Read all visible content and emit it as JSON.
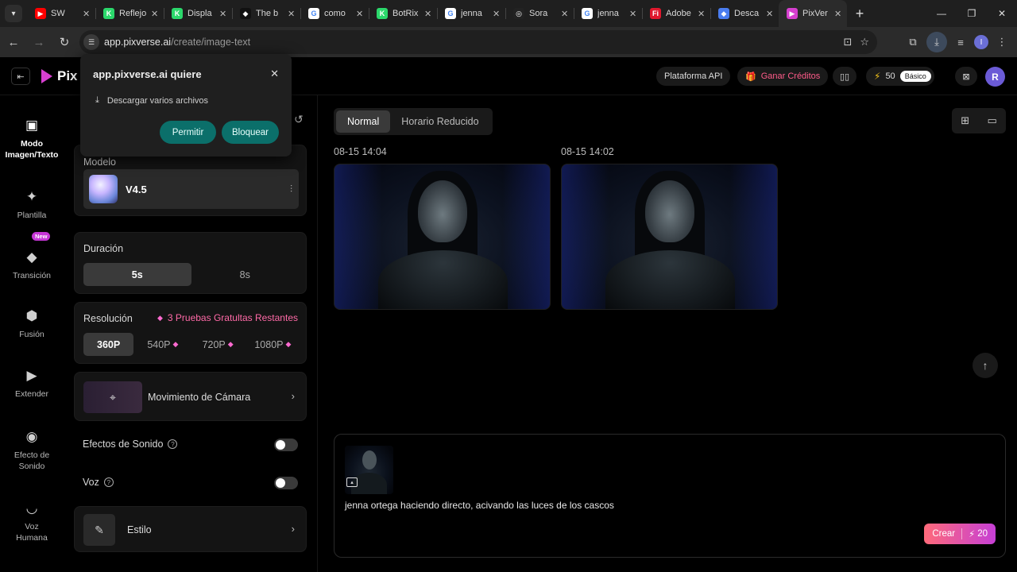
{
  "browser": {
    "tabs": [
      {
        "title": "SW",
        "favicon_color": "#ff0000",
        "favicon_glyph": "▶",
        "active": false
      },
      {
        "title": "Reflejo",
        "favicon_color": "#2bd86b",
        "favicon_glyph": "K",
        "active": false
      },
      {
        "title": "Displa",
        "favicon_color": "#2bd86b",
        "favicon_glyph": "K",
        "active": false
      },
      {
        "title": "The b",
        "favicon_color": "#111111",
        "favicon_glyph": "◆",
        "active": false
      },
      {
        "title": "como",
        "favicon_color": "#ffffff",
        "favicon_glyph": "G",
        "active": false
      },
      {
        "title": "BotRix",
        "favicon_color": "#2bd86b",
        "favicon_glyph": "K",
        "active": false
      },
      {
        "title": "jenna",
        "favicon_color": "#ffffff",
        "favicon_glyph": "G",
        "active": false
      },
      {
        "title": "Sora",
        "favicon_color": "#222222",
        "favicon_glyph": "◎",
        "active": false
      },
      {
        "title": "jenna",
        "favicon_color": "#ffffff",
        "favicon_glyph": "G",
        "active": false
      },
      {
        "title": "Adobe",
        "favicon_color": "#e0182d",
        "favicon_glyph": "Fi",
        "active": false
      },
      {
        "title": "Desca",
        "favicon_color": "#4a7df0",
        "favicon_glyph": "◆",
        "active": false
      },
      {
        "title": "PixVer",
        "favicon_color": "#d63fcf",
        "favicon_glyph": "▶",
        "active": true
      }
    ],
    "url_host": "app.pixverse.ai",
    "url_path": "/create/image-text",
    "profile_initial": "I"
  },
  "header": {
    "logo_text": "Pix",
    "api_label": "Plataforma API",
    "credits_label": "Ganar Créditos",
    "energy_value": "50",
    "plan_label": "Básico",
    "avatar_initial": "R"
  },
  "nav": {
    "items": [
      {
        "label": "Modo Imagen/Texto",
        "icon": "image-icon",
        "active": true
      },
      {
        "label": "Plantilla",
        "icon": "sparkle-icon",
        "active": false
      },
      {
        "label": "Transición",
        "icon": "diamond-icon",
        "active": false,
        "badge": "New"
      },
      {
        "label": "Fusión",
        "icon": "cube-icon",
        "active": false
      },
      {
        "label": "Extender",
        "icon": "extend-icon",
        "active": false
      },
      {
        "label": "Efecto de Sonido",
        "icon": "sound-icon",
        "active": false
      },
      {
        "label": "Voz Humana",
        "icon": "lips-icon",
        "active": false
      }
    ]
  },
  "settings": {
    "model_title": "Modelo",
    "model_name": "V4.5",
    "duration_title": "Duración",
    "duration_options": [
      "5s",
      "8s"
    ],
    "duration_selected": "5s",
    "resolution_title": "Resolución",
    "trial_text": "3 Pruebas Gratultas Restantes",
    "resolution_options": [
      "360P",
      "540P",
      "720P",
      "1080P"
    ],
    "resolution_selected": "360P",
    "camera_label": "Movimiento de Cámara",
    "sound_effects_label": "Efectos de Sonido",
    "voice_label": "Voz",
    "style_label": "Estilo"
  },
  "main": {
    "mode_options": [
      "Normal",
      "Horario Reducido"
    ],
    "mode_selected": "Normal",
    "generations": [
      {
        "time": "08-15 14:04"
      },
      {
        "time": "08-15 14:02"
      }
    ],
    "prompt_text": "jenna ortega haciendo directo, acivando las luces de los cascos",
    "create_label": "Crear",
    "create_cost": "20"
  },
  "popup": {
    "title": "app.pixverse.ai quiere",
    "request": "Descargar varios archivos",
    "allow_label": "Permitir",
    "block_label": "Bloquear"
  }
}
